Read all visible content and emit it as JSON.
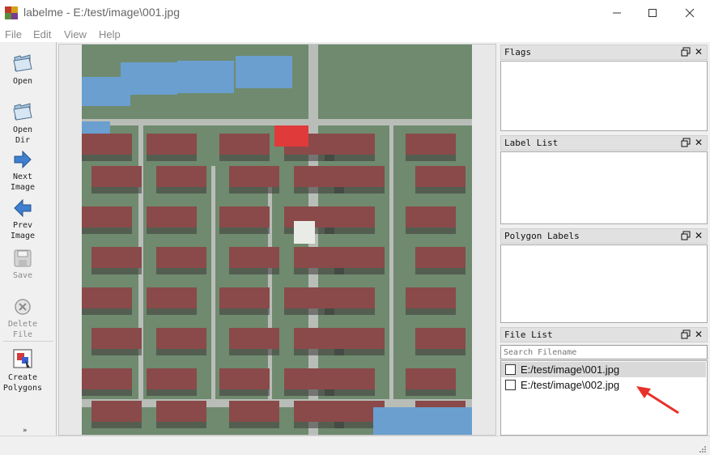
{
  "window": {
    "title": "labelme - E:/test/image\\001.jpg",
    "icon": "labelme-app-icon",
    "controls": [
      "minimize-icon",
      "maximize-icon",
      "close-icon"
    ]
  },
  "menu": {
    "items": [
      "File",
      "Edit",
      "View",
      "Help"
    ]
  },
  "toolbar": {
    "open": "Open",
    "open_dir": "Open\nDir",
    "next_image": "Next\nImage",
    "prev_image": "Prev\nImage",
    "save": "Save",
    "delete_file": "Delete\nFile",
    "create_polygons": "Create\nPolygons",
    "more": "»"
  },
  "docks": {
    "flags": {
      "title": "Flags"
    },
    "label_list": {
      "title": "Label List"
    },
    "polygon_labels": {
      "title": "Polygon Labels"
    },
    "file_list": {
      "title": "File List",
      "search_placeholder": "Search Filename",
      "files": [
        {
          "name": "E:/test/image\\001.jpg",
          "checked": false,
          "selected": true
        },
        {
          "name": "E:/test/image\\002.jpg",
          "checked": false,
          "selected": false
        }
      ]
    }
  },
  "colors": {
    "annotation_arrow": "#e8312a",
    "roof": "#8a4a4a",
    "road": "#b9bdb8",
    "vegetation": "#5f7f5e"
  }
}
